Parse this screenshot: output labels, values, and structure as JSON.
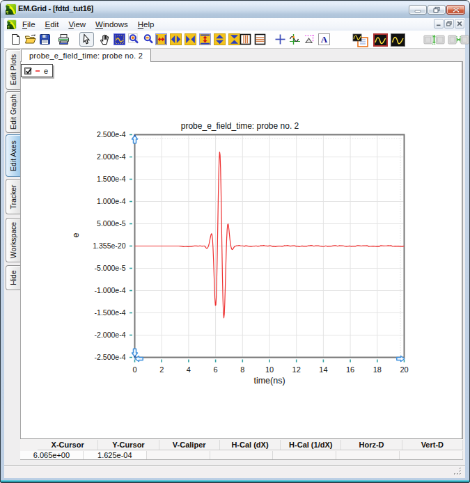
{
  "window": {
    "title": "EM.Grid - [fdtd_tut16]",
    "app_icon": "emgrid-logo",
    "controls": [
      {
        "icon": "minimize-icon",
        "name": "minimize"
      },
      {
        "icon": "restore-icon",
        "name": "restore"
      },
      {
        "icon": "close-icon",
        "name": "close"
      }
    ]
  },
  "menu_bar": {
    "icon": "emgrid-logo",
    "items": [
      {
        "label": "File",
        "mnemonic": "F"
      },
      {
        "label": "Edit",
        "mnemonic": "E"
      },
      {
        "label": "View",
        "mnemonic": "V"
      },
      {
        "label": "Windows",
        "mnemonic": "W"
      },
      {
        "label": "Help",
        "mnemonic": "H"
      }
    ],
    "mdi_controls": [
      {
        "icon": "minimize-icon",
        "name": "minimize"
      },
      {
        "icon": "restore-icon",
        "name": "restore"
      },
      {
        "icon": "close-icon",
        "name": "close"
      }
    ]
  },
  "toolbar": {
    "groups": [
      {
        "buttons": [
          {
            "icon": "new-document"
          },
          {
            "icon": "open-file"
          },
          {
            "icon": "save-file"
          }
        ]
      },
      {
        "buttons": [
          {
            "icon": "print"
          }
        ]
      },
      {
        "buttons": [
          {
            "icon": "select-arrow",
            "pressed": true
          },
          {
            "icon": "pan-hand"
          },
          {
            "icon": "fit-view"
          },
          {
            "icon": "zoom-in"
          },
          {
            "icon": "zoom-out"
          }
        ]
      },
      {
        "buttons": [
          {
            "icon": "expand-x"
          },
          {
            "icon": "stretch-x"
          },
          {
            "icon": "shrink-x"
          },
          {
            "icon": "expand-y"
          },
          {
            "icon": "stretch-y"
          },
          {
            "icon": "shrink-y"
          }
        ]
      },
      {
        "buttons": [
          {
            "icon": "vertical-grid"
          },
          {
            "icon": "horizontal-grid"
          }
        ]
      },
      {
        "buttons": [
          {
            "icon": "crosshair"
          },
          {
            "icon": "tracker"
          },
          {
            "icon": "caliper"
          },
          {
            "icon": "text-label"
          }
        ]
      },
      {
        "buttons": [
          {
            "icon": "copy-plot"
          },
          {
            "icon": "plot-style-red"
          },
          {
            "icon": "plot-style-black"
          }
        ]
      },
      {
        "buttons": [
          {
            "icon": "measure-vertical",
            "disabled": true
          },
          {
            "icon": "measure-horizontal",
            "disabled": true
          }
        ]
      }
    ]
  },
  "document_tabs": [
    {
      "label": "probe_e_field_time: probe no. 2",
      "active": true
    }
  ],
  "side_tabs": [
    {
      "label": "Edit Plots"
    },
    {
      "label": "Edit Graph"
    },
    {
      "label": "Edit Axes",
      "selected": true
    },
    {
      "label": "Tracker"
    },
    {
      "label": "Workspace"
    },
    {
      "label": "Hide"
    }
  ],
  "legend": {
    "entries": [
      {
        "label": "e",
        "checked": true,
        "color": "#f25555"
      }
    ]
  },
  "chart_data": {
    "type": "line",
    "title": "probe_e_field_time: probe no. 2",
    "xlabel": "time(ns)",
    "ylabel": "e",
    "xlim": [
      0,
      20
    ],
    "ylim": [
      -0.00025,
      0.00025
    ],
    "x_ticks": [
      0,
      2,
      4,
      6,
      8,
      10,
      12,
      14,
      16,
      18,
      20
    ],
    "x_tick_labels": [
      "0",
      "2",
      "4",
      "6",
      "8",
      "10",
      "12",
      "14",
      "16",
      "18",
      "20"
    ],
    "y_ticks": [
      0.00025,
      0.0002,
      0.00015,
      0.0001,
      5e-05,
      0.0,
      -5e-05,
      -0.0001,
      -0.00015,
      -0.0002,
      -0.00025
    ],
    "y_tick_labels": [
      "2.500e-4",
      "2.000e-4",
      "1.500e-4",
      "1.000e-4",
      "5.000e-5",
      "1.355e-20",
      "-5.000e-5",
      "-1.000e-4",
      "-1.500e-4",
      "-2.000e-4",
      "-2.500e-4"
    ],
    "grid": true,
    "legend_position": "top-left",
    "series": [
      {
        "name": "e",
        "color": "#ee3030",
        "x": [
          0.0,
          0.25,
          0.5,
          0.75,
          1.0,
          1.25,
          1.5,
          1.75,
          2.0,
          2.25,
          2.5,
          2.75,
          3.0,
          3.25,
          3.37,
          3.49,
          3.61,
          3.73,
          3.85,
          3.97,
          4.09,
          4.21,
          4.33,
          4.45,
          4.57,
          4.69,
          4.725,
          4.76,
          4.795,
          4.83,
          4.865,
          4.9,
          4.935,
          4.97,
          5.005,
          5.04,
          5.075,
          5.11,
          5.145,
          5.18,
          5.215,
          5.25,
          5.285,
          5.32,
          5.355,
          5.39,
          5.425,
          5.46,
          5.495,
          5.53,
          5.565,
          5.6,
          5.635,
          5.67,
          5.705,
          5.74,
          5.775,
          5.81,
          5.845,
          5.88,
          5.915,
          5.95,
          5.985,
          6.02,
          6.055,
          6.09,
          6.125,
          6.16,
          6.195,
          6.23,
          6.265,
          6.3,
          6.335,
          6.37,
          6.405,
          6.44,
          6.475,
          6.51,
          6.545,
          6.58,
          6.615,
          6.65,
          6.685,
          6.72,
          6.755,
          6.79,
          6.825,
          6.86,
          6.895,
          6.93,
          6.965,
          7.0,
          7.035,
          7.07,
          7.105,
          7.14,
          7.175,
          7.21,
          7.245,
          7.28,
          7.315,
          7.35,
          7.385,
          7.42,
          7.455,
          7.49,
          7.525,
          7.56,
          7.595,
          7.63,
          7.665,
          7.7,
          7.735,
          7.77,
          7.805,
          7.84,
          7.875,
          7.91,
          8.02,
          8.13,
          8.24,
          8.35,
          8.46,
          8.57,
          8.68,
          8.79,
          8.9,
          9.01,
          9.12,
          9.23,
          9.34,
          9.45,
          9.56,
          9.67,
          9.78,
          9.89,
          10.0,
          10.11,
          10.22,
          10.33,
          10.44,
          10.55,
          10.66,
          10.77,
          10.88,
          10.99,
          11.1,
          11.21,
          11.32,
          11.43,
          11.54,
          11.65,
          11.76,
          11.87,
          11.98,
          12.09,
          12.2,
          12.31,
          12.42,
          12.53,
          12.64,
          12.75,
          12.86,
          12.97,
          13.08,
          13.19,
          13.3,
          13.41,
          13.52,
          13.63,
          13.74,
          13.85,
          13.96,
          14.07,
          14.18,
          14.29,
          14.4,
          14.51,
          14.62,
          14.73,
          14.84,
          14.95,
          15.06,
          15.17,
          15.28,
          15.39,
          15.5,
          15.61,
          15.72,
          15.83,
          15.94,
          16.05,
          16.16,
          16.27,
          16.38,
          16.49,
          16.6,
          16.71,
          16.82,
          16.93,
          17.04,
          17.15,
          17.26,
          17.37,
          17.48,
          17.59,
          17.7,
          17.81,
          17.92,
          18.03,
          18.14,
          18.25,
          18.36,
          18.47,
          18.58,
          18.69,
          18.8,
          18.91,
          19.02,
          19.13,
          19.24,
          19.35,
          19.46,
          19.57,
          19.68,
          19.79,
          19.9,
          20.0
        ],
        "y": [
          0.0,
          0.0,
          0.0,
          0.0,
          0.0,
          0.0,
          0.0,
          0.0,
          0.0,
          0.0,
          0.0,
          0.0,
          9.481e-32,
          -2.666e-27,
          -8.975e-08,
          -7.02e-07,
          -1.37e-06,
          -1.164e-06,
          -9.137e-07,
          -1.409e-06,
          -1.087e-06,
          -9.636e-07,
          -3.009e-07,
          1.35e-07,
          1.222e-07,
          -2.767e-07,
          -1.953e-07,
          -3.733e-08,
          1.355e-07,
          2.56e-07,
          2.781e-07,
          1.956e-07,
          4.467e-08,
          -1.104e-07,
          -2.036e-07,
          -1.952e-07,
          -9.309e-08,
          3.89e-08,
          7.696e-08,
          -1.674e-07,
          -9.126e-07,
          -2.237e-06,
          -3.828e-06,
          -5.028e-06,
          -5.316e-06,
          -4.662e-06,
          -3.242e-06,
          -1.031e-06,
          2.159e-06,
          6.386e-06,
          1.144e-05,
          1.69e-05,
          2.215e-05,
          2.626e-05,
          2.778e-05,
          2.471e-05,
          1.489e-05,
          -3.058e-06,
          -2.882e-05,
          -5.985e-05,
          -9.152e-05,
          -0.000118,
          -0.0001333,
          -0.0001326,
          -0.0001133,
          -7.56e-05,
          -2.287e-05,
          3.872e-05,
          0.000101,
          0.0001554,
          0.0001939,
          0.0002111,
          0.0002044,
          0.0001742,
          0.0001241,
          6.103e-05,
          -6.462e-06,
          -6.921e-05,
          -0.0001192,
          -0.0001507,
          -0.0001614,
          -0.0001521,
          -0.0001268,
          -9.109e-05,
          -5.157e-05,
          -1.426e-05,
          1.623e-05,
          3.719e-05,
          4.797e-05,
          4.962e-05,
          4.438e-05,
          3.498e-05,
          2.404e-05,
          1.366e-05,
          5.118e-06,
          -1.124e-06,
          -5.174e-06,
          -7.333e-06,
          -7.843e-06,
          -6.98e-06,
          -5.276e-06,
          -3.435e-06,
          -2.023e-06,
          -1.089e-06,
          -4.607e-07,
          1.151e-08,
          3.609e-07,
          5.731e-07,
          6.764e-07,
          7.587e-07,
          9.044e-07,
          1.115e-06,
          1.289e-06,
          1.223e-06,
          9.251e-07,
          5.912e-07,
          3.834e-07,
          3.742e-07,
          3.872e-07,
          -5.749e-07,
          6.681e-07,
          2.198e-07,
          -7.908e-07,
          -9.365e-07,
          -1.129e-06,
          -4.22e-07,
          -3.479e-07,
          4.391e-07,
          -6.96e-07,
          -3.468e-07,
          8.672e-07,
          7.105e-07,
          1.255e-06,
          4.934e-07,
          2.444e-07,
          -2.337e-07,
          6.788e-07,
          4.644e-07,
          -8.831e-07,
          -5.379e-07,
          -1.335e-06,
          -5.854e-07,
          -9.715e-08,
          -1.656e-08,
          -6.339e-07,
          -5.573e-07,
          8.223e-07,
          4.372e-07,
          1.359e-06,
          6.869e-07,
          -6.623e-08,
          2.8e-07,
          5.818e-07,
          6.148e-07,
          -6.794e-07,
          -4.146e-07,
          -1.328e-06,
          -7.815e-07,
          2.15e-07,
          -5.231e-07,
          -5.418e-07,
          -6.334e-07,
          4.617e-07,
          4.633e-07,
          1.253e-06,
          8.511e-07,
          -3.205e-07,
          7.157e-07,
          5.282e-07,
          6.179e-07,
          -1.883e-07,
          -5.646e-07,
          -1.148e-06,
          -8.792e-07,
          3.608e-07,
          -8.357e-07,
          -5.483e-07,
          -5.807e-07,
          -1.127e-07,
          6.921e-07,
          1.032e-06,
          8.546e-07,
          -3.246e-07,
          8.722e-07,
          6.012e-07,
          5.402e-07,
          4.079e-07,
          -8.154e-07,
          -9.224e-07,
          -7.74e-07,
          2.135e-07,
          -8.27e-07,
          -6.783e-07,
          -5.169e-07,
          -6.642e-07,
          9.058e-07,
          8.319e-07,
          6.435e-07,
          -4.197e-08,
          7.134e-07,
          7.658e-07,
          5.3e-07,
          8.54e-07,
          -9.407e-07,
          -7.673e-07,
          -4.781e-07,
          -1.648e-07,
          -5.537e-07,
          -8.473e-07,
          -5.931e-07,
          -9.597e-07,
          9.071e-07,
          7.277e-07,
          2.996e-07,
          3.747e-07,
          3.754e-07,
          9.08e-07,
          7.114e-07,
          9.76e-07,
          -8.034e-07,
          -7.053e-07,
          -1.332e-07,
          -5.539e-07,
          -2.059e-07,
          -9.373e-07,
          -8.798e-07,
          -9.116e-07,
          4.774e-07
        ]
      }
    ]
  },
  "cursor_table": {
    "columns": [
      "X-Cursor",
      "Y-Cursor",
      "V-Caliper",
      "H-Cal (dX)",
      "H-Cal (1/dX)",
      "Horz-D",
      "Vert-D"
    ],
    "values": [
      "6.065e+00",
      "1.625e-04",
      "",
      "",
      "",
      "",
      ""
    ]
  },
  "colors": {
    "accent_tab_selected": "#aed4f0",
    "curve": "#ee3030",
    "tick": "#36a3a3",
    "axis_handle": "#4392dd",
    "frame_blue": "#c0d1e7",
    "frame_teal_edge": "#38c3d4",
    "titlebar_top": "#e0eaf7",
    "titlebar_bottom": "#a7bcd3"
  }
}
